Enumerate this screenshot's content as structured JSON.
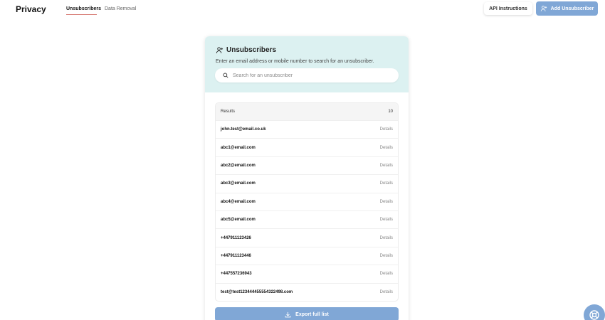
{
  "header": {
    "app_title": "Privacy",
    "tabs": [
      {
        "label": "Unsubscribers",
        "active": true
      },
      {
        "label": "Data Removal",
        "active": false
      }
    ],
    "api_button": "API Instructions",
    "add_button": "Add Unsubscriber"
  },
  "card": {
    "title": "Unsubscribers",
    "description": "Enter an email address or mobile number to search for an unsubscriber.",
    "search_placeholder": "Search for an unsubscriber",
    "results_label": "Results",
    "results_count": "10",
    "rows": [
      {
        "email": "john.test@email.co.uk",
        "action": "Details"
      },
      {
        "email": "abc1@email.com",
        "action": "Details"
      },
      {
        "email": "abc2@email.com",
        "action": "Details"
      },
      {
        "email": "abc3@email.com",
        "action": "Details"
      },
      {
        "email": "abc4@email.com",
        "action": "Details"
      },
      {
        "email": "abc5@email.com",
        "action": "Details"
      },
      {
        "email": "+447911123426",
        "action": "Details"
      },
      {
        "email": "+447911123446",
        "action": "Details"
      },
      {
        "email": "+447557236943",
        "action": "Details"
      },
      {
        "email": "test@test123444455554322498.com",
        "action": "Details"
      }
    ],
    "export_button": "Export full list"
  },
  "icons": {
    "add_user": "add-user-icon",
    "search": "search-icon",
    "download": "download-icon",
    "help": "lifebuoy-icon"
  },
  "colors": {
    "accent": "#80a7d6",
    "card_header_bg": "#dcf1f1",
    "active_tab_underline": "#d77a74"
  }
}
